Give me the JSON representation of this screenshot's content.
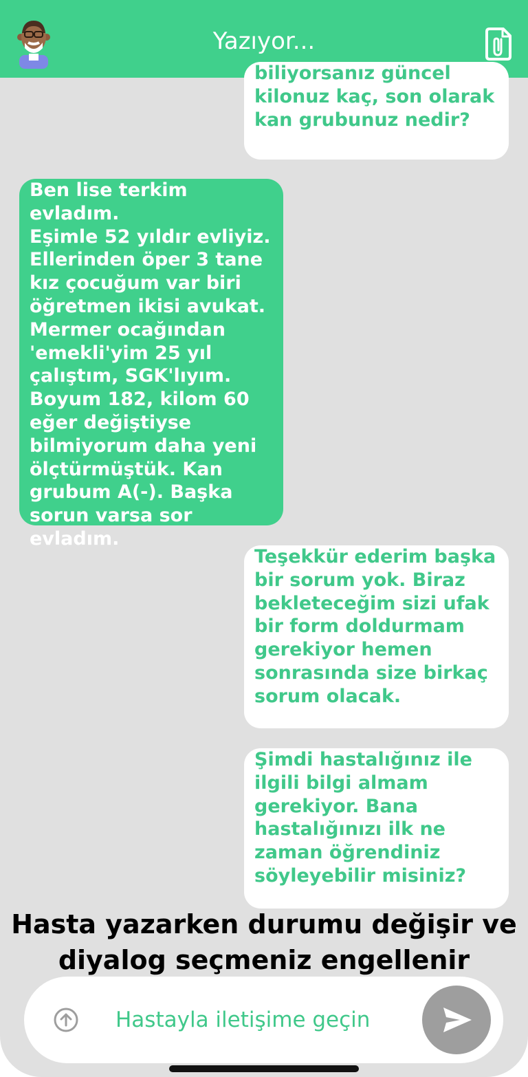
{
  "header": {
    "title": "Yazıyor...",
    "background": "#40d08c",
    "avatar_icon": "elderly-man-avatar-icon",
    "attach_icon": "document-attach-icon"
  },
  "messages": [
    {
      "side": "doctor",
      "text": "biliyorsanız güncel\nkilonuz kaç, son olarak\nkan grubunuz nedir?"
    },
    {
      "side": "patient",
      "text": "Ben lise terkim evladım.\nEşimle 52 yıldır evliyiz.\nEllerinden öper 3 tane\nkız çocuğum var biri\nöğretmen ikisi avukat.\nMermer ocağından\n'emekli'yim 25 yıl\nçalıştım, SGK'lıyım.\nBoyum 182, kilom 60\neğer değiştiyse\nbilmiyorum daha yeni\nölçtürmüştük. Kan\ngrubum A(-). Başka\nsorun varsa sor evladım."
    },
    {
      "side": "doctor",
      "text": "Teşekkür ederim başka\nbir sorum yok. Biraz\nbekleteceğim sizi ufak\nbir form doldurmam\ngerekiyor hemen\nsonrasında size birkaç\nsorum olacak."
    },
    {
      "side": "doctor",
      "text": "Şimdi hastalığınız ile\nilgili bilgi almam\ngerekiyor. Bana\nhastalığınızı ilk ne\nzaman öğrendiniz\nsöyleyebilir misiniz?"
    }
  ],
  "overlay": {
    "text": "Hasta yazarken durumu değişir ve\ndiyalog seçmeniz engellenir"
  },
  "composer": {
    "placeholder": "Hastayla iletişime geçin",
    "upload_icon": "upload-arrow-icon",
    "send_icon": "send-icon",
    "send_disabled": true
  },
  "colors": {
    "accent": "#40d08c",
    "background": "#e0e0e0",
    "doctor_text": "#40c88a",
    "send_disabled": "#9e9e9e"
  }
}
